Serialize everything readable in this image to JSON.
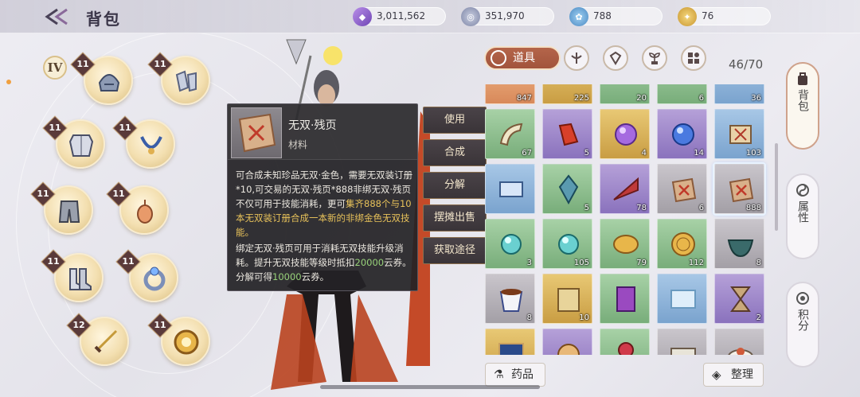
{
  "header": {
    "title": "背包"
  },
  "currencies": [
    {
      "icon": "purple-gem-icon",
      "value": "3,011,562"
    },
    {
      "icon": "silver-coin-icon",
      "value": "351,970"
    },
    {
      "icon": "blue-token-icon",
      "value": "788"
    },
    {
      "icon": "gold-token-icon",
      "value": "76"
    }
  ],
  "equipment": {
    "tier": "IV",
    "slots": [
      {
        "name": "helmet",
        "level": "11"
      },
      {
        "name": "gloves",
        "level": "11"
      },
      {
        "name": "armor",
        "level": "11"
      },
      {
        "name": "necklace",
        "level": "11"
      },
      {
        "name": "pants",
        "level": "11"
      },
      {
        "name": "pendant",
        "level": "11"
      },
      {
        "name": "boots",
        "level": "11"
      },
      {
        "name": "ring",
        "level": "11"
      },
      {
        "name": "weapon",
        "level": "12"
      },
      {
        "name": "talisman",
        "level": "11"
      }
    ]
  },
  "tooltip": {
    "name": "无双·残页",
    "type": "材料",
    "desc_1": "可合成未知珍品无双·金色，需要无双装订册*10,可交易的无双·残页*888非绑无双·残页不仅可用于技能消耗，更可",
    "desc_1_hl": "集齐888个与10本无双装订册合成一本新的非绑金色无双技能。",
    "desc_2a": "绑定无双·残页可用于消耗无双技能升级消耗。提升无双技能等级时抵扣",
    "desc_2_num": "20000",
    "desc_2b": "云券。分解可得",
    "desc_2_num2": "10000",
    "desc_2c": "云券。"
  },
  "actions": [
    "使用",
    "合成",
    "分解",
    "摆摊出售",
    "获取途径"
  ],
  "tabs": {
    "active": "道具",
    "others": [
      "weapon-category-icon",
      "gem-category-icon",
      "plant-category-icon",
      "misc-category-icon"
    ]
  },
  "capacity": "46/70",
  "grid_items": [
    {
      "rarity": "orange",
      "qty": "847",
      "icon": "partial"
    },
    {
      "rarity": "gold",
      "qty": "225",
      "icon": "partial"
    },
    {
      "rarity": "green",
      "qty": "20",
      "icon": "partial"
    },
    {
      "rarity": "green",
      "qty": "6",
      "icon": "partial"
    },
    {
      "rarity": "blue",
      "qty": "36",
      "icon": "partial"
    },
    {
      "rarity": "green",
      "qty": "67",
      "icon": "horn"
    },
    {
      "rarity": "purple",
      "qty": "5",
      "icon": "red-shoe"
    },
    {
      "rarity": "gold",
      "qty": "4",
      "icon": "purple-orb"
    },
    {
      "rarity": "purple",
      "qty": "14",
      "icon": "blue-orb"
    },
    {
      "rarity": "blue",
      "qty": "103",
      "icon": "scroll-bundle"
    },
    {
      "rarity": "blue",
      "qty": "",
      "icon": "blue-scroll"
    },
    {
      "rarity": "green",
      "qty": "5",
      "icon": "crystal"
    },
    {
      "rarity": "purple",
      "qty": "78",
      "icon": "red-fan"
    },
    {
      "rarity": "grey",
      "qty": "6",
      "icon": "torn-page"
    },
    {
      "rarity": "grey",
      "qty": "888",
      "icon": "torn-page"
    },
    {
      "rarity": "green",
      "qty": "3",
      "icon": "teal-orb"
    },
    {
      "rarity": "green",
      "qty": "105",
      "icon": "teal-orb"
    },
    {
      "rarity": "green",
      "qty": "79",
      "icon": "gold-disc"
    },
    {
      "rarity": "green",
      "qty": "112",
      "icon": "gold-medal"
    },
    {
      "rarity": "grey",
      "qty": "8",
      "icon": "bowl"
    },
    {
      "rarity": "grey",
      "qty": "8",
      "icon": "tea-cup"
    },
    {
      "rarity": "gold",
      "qty": "10",
      "icon": "book"
    },
    {
      "rarity": "green",
      "qty": "",
      "icon": "card"
    },
    {
      "rarity": "blue",
      "qty": "",
      "icon": "cloud-note"
    },
    {
      "rarity": "purple",
      "qty": "2",
      "icon": "hourglass"
    },
    {
      "rarity": "gold",
      "qty": "",
      "icon": "map"
    },
    {
      "rarity": "purple",
      "qty": "",
      "icon": "dog"
    },
    {
      "rarity": "green",
      "qty": "",
      "icon": "rose"
    },
    {
      "rarity": "grey",
      "qty": "",
      "icon": "table"
    },
    {
      "rarity": "grey",
      "qty": "",
      "icon": "dishes"
    }
  ],
  "bottom": {
    "potion_label": "药品",
    "sort_label": "整理"
  },
  "side_tabs": [
    {
      "label": "背包",
      "active": true
    },
    {
      "label": "属性",
      "active": false
    },
    {
      "label": "积分",
      "active": false
    }
  ]
}
